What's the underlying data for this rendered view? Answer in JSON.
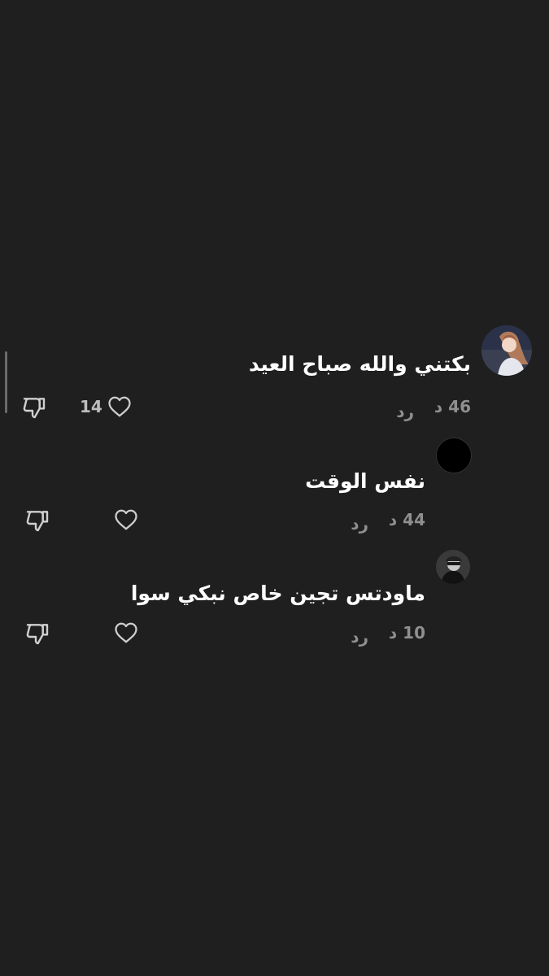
{
  "comments": [
    {
      "text": "بكتني والله صباح العيد",
      "time": "46 د",
      "reply_label": "رد",
      "like_count": "14",
      "avatar": "woman-portrait-avatar"
    },
    {
      "text": "نفس الوقت",
      "time": "44 د",
      "reply_label": "رد",
      "like_count": "",
      "avatar": "black-circle-avatar"
    },
    {
      "text": "ماودتس تجين خاص نبكي سوا",
      "time": "10 د",
      "reply_label": "رد",
      "like_count": "",
      "avatar": "monochrome-photo-avatar"
    }
  ],
  "icons": {
    "like": "heart-outline-icon",
    "dislike": "thumbs-down-outline-icon"
  },
  "colors": {
    "background": "#1f1f1f",
    "text": "#ffffff",
    "meta": "#8f8f8f"
  }
}
